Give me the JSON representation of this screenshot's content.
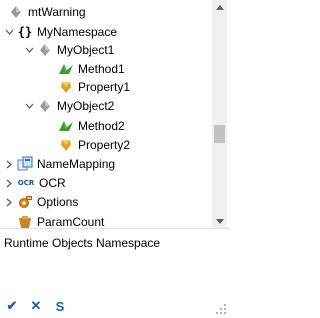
{
  "tree": {
    "items": [
      {
        "label": "mtWarning",
        "icon": "diamond-icon"
      },
      {
        "label": "MyNamespace",
        "icon": "braces-icon"
      },
      {
        "label": "MyObject1",
        "icon": "diamond-icon"
      },
      {
        "label": "Method1",
        "icon": "method-icon"
      },
      {
        "label": "Property1",
        "icon": "property-icon"
      },
      {
        "label": "MyObject2",
        "icon": "diamond-icon"
      },
      {
        "label": "Method2",
        "icon": "method-icon"
      },
      {
        "label": "Property2",
        "icon": "property-icon"
      },
      {
        "label": "NameMapping",
        "icon": "name-mapping-icon"
      },
      {
        "label": "OCR",
        "icon": "ocr-icon"
      },
      {
        "label": "Options",
        "icon": "options-icon"
      },
      {
        "label": "ParamCount",
        "icon": "param-icon"
      }
    ],
    "ocr_badge": "OCR"
  },
  "description": "Runtime Objects Namespace",
  "actions": {
    "ok_glyph": "✔",
    "cancel_glyph": "✕",
    "s_label": "S"
  },
  "colors": {
    "accent": "#1a5fb4",
    "method_green": "#3a9b2f",
    "property_gold": "#d9a62b"
  }
}
